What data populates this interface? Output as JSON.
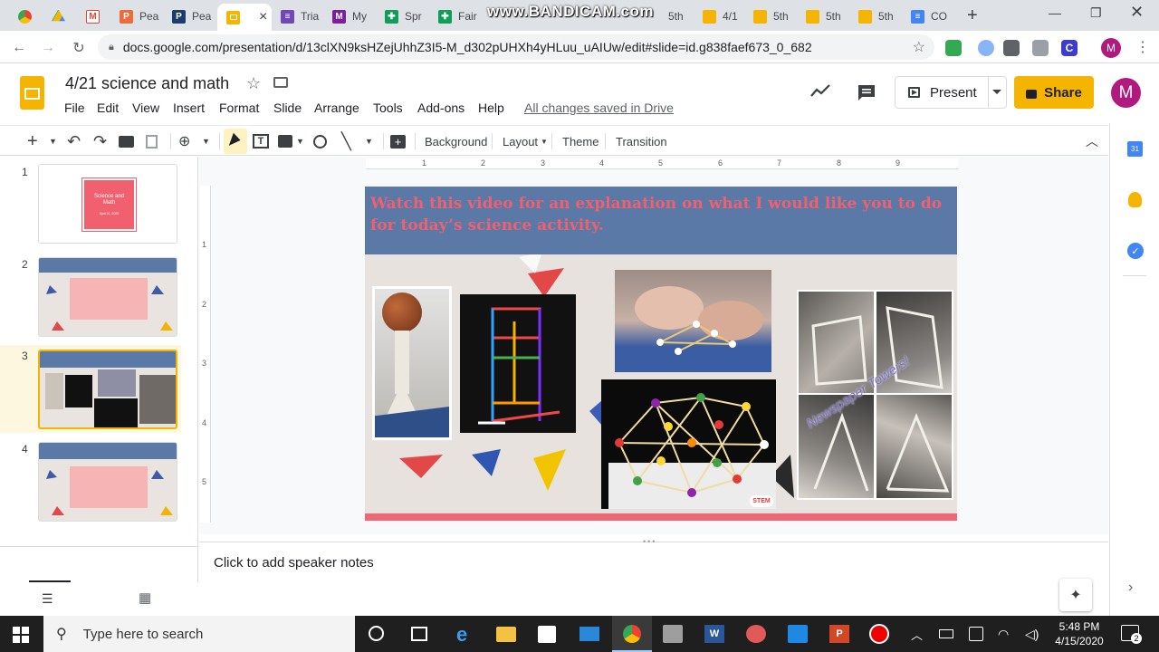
{
  "browser": {
    "tabs": [
      {
        "label": "",
        "icon": "chrome-icon",
        "color": "#4285f4"
      },
      {
        "label": "",
        "icon": "drive-icon",
        "color": "#0f9d58"
      },
      {
        "label": "",
        "icon": "gmail-icon",
        "color": "#ea4335"
      },
      {
        "label": "Pea",
        "icon": "pear-deck-icon",
        "color": "#ee6b3b"
      },
      {
        "label": "Pea",
        "icon": "pear-deck-icon",
        "color": "#1a3c6e"
      },
      {
        "label": "",
        "icon": "slides-icon",
        "color": "#f4b400"
      },
      {
        "label": "Tria",
        "icon": "forms-icon",
        "color": "#7248b9"
      },
      {
        "label": "My",
        "icon": "m-icon",
        "color": "#7b1fa2"
      },
      {
        "label": "Spr",
        "icon": "sheets-icon",
        "color": "#0f9d58"
      },
      {
        "label": "Fair",
        "icon": "sheets-icon",
        "color": "#0f9d58"
      },
      {
        "label": "5th",
        "icon": "slides-icon",
        "color": "#f4b400"
      },
      {
        "label": "4/1",
        "icon": "slides-icon",
        "color": "#f4b400"
      },
      {
        "label": "5th",
        "icon": "slides-icon",
        "color": "#f4b400"
      },
      {
        "label": "5th",
        "icon": "slides-icon",
        "color": "#f4b400"
      },
      {
        "label": "5th",
        "icon": "slides-icon",
        "color": "#f4b400"
      },
      {
        "label": "CO",
        "icon": "docs-icon",
        "color": "#4285f4"
      }
    ],
    "watermark": "www.BANDICAM.com",
    "url": "docs.google.com/presentation/d/13clXN9ksHZejUhhZ3I5-M_d302pUHXh4yHLuu_uAIUw/edit#slide=id.g838faef673_0_682",
    "profile_initial": "M"
  },
  "app": {
    "title": "4/21 science and math",
    "menus": [
      "File",
      "Edit",
      "View",
      "Insert",
      "Format",
      "Slide",
      "Arrange",
      "Tools",
      "Add-ons",
      "Help"
    ],
    "saved_status": "All changes saved in Drive",
    "present_label": "Present",
    "share_label": "Share",
    "avatar_initial": "M"
  },
  "toolbar": {
    "background_label": "Background",
    "layout_label": "Layout",
    "theme_label": "Theme",
    "transition_label": "Transition"
  },
  "ruler": {
    "h_ticks": [
      "1",
      "2",
      "3",
      "4",
      "5",
      "6",
      "7",
      "8",
      "9"
    ],
    "v_ticks": [
      "1",
      "2",
      "3",
      "4",
      "5"
    ]
  },
  "filmstrip": {
    "slides": [
      {
        "number": "1",
        "title": "Science and Math",
        "subtitle": "April 21, 2020"
      },
      {
        "number": "2"
      },
      {
        "number": "3"
      },
      {
        "number": "4"
      }
    ],
    "selected": "3"
  },
  "slide": {
    "title": "Watch this video for an explanation on what I would like you to do for today’s science activity.",
    "photo_caption": "Newspaper Towers!",
    "stem_logo": "STEM"
  },
  "notes": {
    "placeholder": "Click to add speaker notes"
  },
  "taskbar": {
    "search_placeholder": "Type here to search",
    "time": "5:48 PM",
    "date": "4/15/2020",
    "notification_count": "2"
  },
  "colors": {
    "slides_yellow": "#f4b400",
    "slide_band": "#5a79a6",
    "slide_title": "#f0606f",
    "selected_thumb": "#fef7e0"
  }
}
